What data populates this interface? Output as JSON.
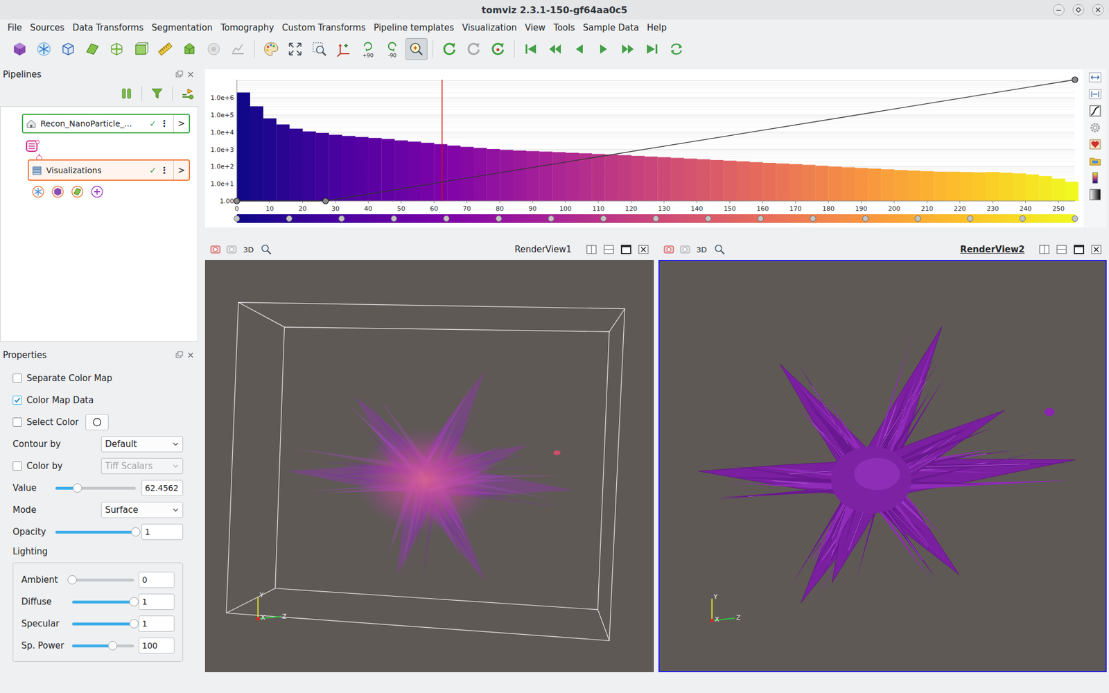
{
  "window": {
    "title": "tomviz 2.3.1-150-gf64aa0c5"
  },
  "menu": [
    "File",
    "Sources",
    "Data Transforms",
    "Segmentation",
    "Tomography",
    "Custom Transforms",
    "Pipeline templates",
    "Visualization",
    "View",
    "Tools",
    "Sample Data",
    "Help"
  ],
  "toolbar": {
    "groups": [
      [
        {
          "active": false
        },
        {
          "active": false
        },
        {
          "active": false
        },
        {
          "active": false
        },
        {
          "active": false
        },
        {
          "active": false
        },
        {
          "active": false
        },
        {
          "active": false
        },
        {
          "active": false
        },
        {
          "active": false
        }
      ],
      [
        {
          "active": false
        },
        {
          "active": false
        },
        {
          "active": false
        },
        {
          "active": false
        },
        {
          "active": false,
          "label": "+90"
        },
        {
          "active": false,
          "label": "-90"
        },
        {
          "active": true
        }
      ],
      [
        {
          "active": false
        },
        {
          "active": false
        },
        {
          "active": false
        }
      ],
      [
        {
          "active": false
        },
        {
          "active": false
        },
        {
          "active": false
        },
        {
          "active": false
        },
        {
          "active": false
        },
        {
          "active": false
        },
        {
          "active": false
        }
      ]
    ]
  },
  "pipelines": {
    "title": "Pipelines",
    "nodes": [
      {
        "name": "Recon_NanoParticle_...",
        "kind": "data",
        "check": "✓",
        "menu": "⋮",
        "expand": ">"
      },
      {
        "name": "Visualizations",
        "kind": "visualization",
        "check": "✓",
        "menu": "⋮",
        "expand": ">"
      }
    ]
  },
  "properties": {
    "title": "Properties",
    "rows": [
      {
        "kind": "checkbox",
        "label": "Separate Color Map",
        "checked": false
      },
      {
        "kind": "checkbox",
        "label": "Color Map Data",
        "checked": true
      },
      {
        "kind": "checkbox-color",
        "label": "Select Color",
        "checked": false
      },
      {
        "kind": "dropdown",
        "label": "Contour by",
        "value": "Default",
        "disabled": false
      },
      {
        "kind": "checkbox-dropdown",
        "label": "Color by",
        "checked": false,
        "value": "Tiff Scalars",
        "disabled": true
      },
      {
        "kind": "slider",
        "label": "Value",
        "level": 0.27,
        "reading": "62.4562"
      },
      {
        "kind": "dropdown",
        "label": "Mode",
        "value": "Surface",
        "disabled": false
      },
      {
        "kind": "slider",
        "label": "Opacity",
        "level": 1,
        "reading": "1"
      }
    ],
    "lighting": {
      "title": "Lighting",
      "rows": [
        {
          "label": "Ambient",
          "level": 0,
          "reading": "0"
        },
        {
          "label": "Diffuse",
          "level": 1,
          "reading": "1"
        },
        {
          "label": "Specular",
          "level": 1,
          "reading": "1"
        },
        {
          "label": "Sp. Power",
          "level": 0.65,
          "reading": "100"
        }
      ]
    }
  },
  "histogram": {
    "y_ticks": [
      "1.00",
      "1.0e+1",
      "1.0e+2",
      "1.0e+3",
      "1.0e+4",
      "1.0e+5",
      "1.0e+6"
    ],
    "x_ticks": [
      "0",
      "10",
      "20",
      "30",
      "40",
      "50",
      "60",
      "70",
      "80",
      "90",
      "100",
      "110",
      "120",
      "130",
      "140",
      "150",
      "160",
      "170",
      "180",
      "190",
      "200",
      "210",
      "220",
      "230",
      "240",
      "250"
    ],
    "bin_width": 4,
    "counts": [
      2000000,
      316000,
      63000,
      28000,
      16000,
      11000,
      9000,
      7000,
      6000,
      5200,
      4600,
      4000,
      3300,
      2800,
      2400,
      2000,
      1650,
      1400,
      1200,
      1050,
      930,
      850,
      790,
      740,
      690,
      630,
      590,
      540,
      500,
      460,
      420,
      380,
      350,
      320,
      290,
      265,
      240,
      220,
      200,
      180,
      165,
      150,
      138,
      126,
      112,
      100,
      91,
      83,
      76,
      69,
      63,
      58,
      54,
      50,
      50,
      48,
      46,
      48,
      44,
      40,
      35,
      28,
      20,
      13
    ],
    "marker": 62.46,
    "opacity_points": [
      [
        0,
        0
      ],
      [
        27,
        0
      ],
      [
        255,
        1
      ]
    ],
    "color_points": [
      0,
      15.94,
      31.88,
      47.81,
      63.75,
      79.69,
      95.63,
      111.56,
      127.5,
      143.44,
      159.38,
      175.31,
      191.25,
      207.19,
      223.13,
      239.06,
      255
    ]
  },
  "render_views": [
    {
      "title": "RenderView1",
      "mode": "3D",
      "active": false,
      "kind": "volume",
      "bounding_box": true,
      "axes": [
        "Y",
        "X",
        "Z"
      ]
    },
    {
      "title": "RenderView2",
      "mode": "3D",
      "active": true,
      "kind": "surface",
      "bounding_box": false,
      "axes": [
        "Y",
        "X",
        "Z"
      ]
    }
  ]
}
